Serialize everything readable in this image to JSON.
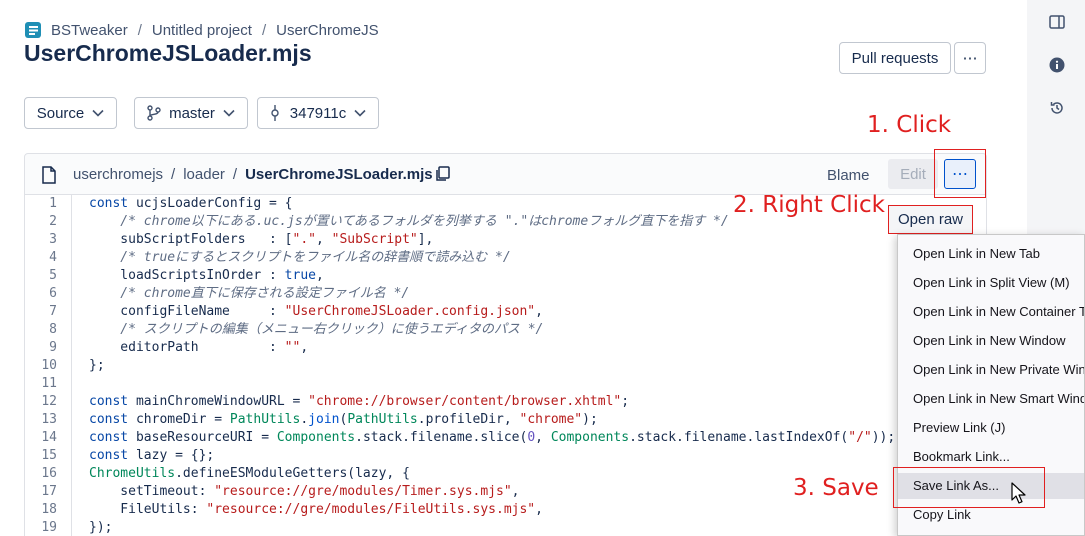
{
  "breadcrumb": {
    "workspace": "BSTweaker",
    "project": "Untitled project",
    "repo": "UserChromeJS"
  },
  "page_title": "UserChromeJSLoader.mjs",
  "header": {
    "pull_requests": "Pull requests",
    "more": "⋯"
  },
  "selectors": {
    "source": "Source",
    "branch": "master",
    "commit": "347911c"
  },
  "file_header": {
    "path": [
      "userchromejs",
      "loader"
    ],
    "current": "UserChromeJSLoader.mjs",
    "blame": "Blame",
    "edit": "Edit",
    "dots": "⋯",
    "open_raw": "Open raw"
  },
  "code_lines": [
    "1",
    "2",
    "3",
    "4",
    "5",
    "6",
    "7",
    "8",
    "9",
    "10",
    "11",
    "12",
    "13",
    "14",
    "15",
    "16",
    "17",
    "18",
    "19"
  ],
  "code": {
    "l1": [
      "const",
      " ucjsLoaderConfig = {"
    ],
    "l2": "    /* chrome以下にある.uc.jsが置いてあるフォルダを列挙する \".\"はchromeフォルグ直下を指す */",
    "l3": [
      "    subScriptFolders   : [",
      "\".\"",
      ", ",
      "\"SubScript\"",
      "],"
    ],
    "l4": "    /* trueにするとスクリプトをファイル名の辞書順で読み込む */",
    "l5": [
      "    loadScriptsInOrder : ",
      "true",
      ","
    ],
    "l6": "    /* chrome直下に保存される設定ファイル名 */",
    "l7": [
      "    configFileName     : ",
      "\"UserChromeJSLoader.config.json\"",
      ","
    ],
    "l8": "    /* スクリプトの編集（メニュー右クリック）に使うエディタのパス */",
    "l9": [
      "    editorPath         : ",
      "\"\"",
      ","
    ],
    "l10": "};",
    "l12": [
      "const",
      " mainChromeWindowURL = ",
      "\"chrome://browser/content/browser.xhtml\"",
      ";"
    ],
    "l13": [
      "const",
      " chromeDir = ",
      "PathUtils",
      ".",
      "join",
      "(",
      "PathUtils",
      ".profileDir, ",
      "\"chrome\"",
      ");"
    ],
    "l14": [
      "const",
      " baseResourceURI = ",
      "Components",
      ".stack.filename.slice(",
      "0",
      ", ",
      "Components",
      ".stack.filename.lastIndexOf(",
      "\"/\"",
      "));"
    ],
    "l15": [
      "const",
      " lazy = {};"
    ],
    "l16": [
      "ChromeUtils",
      ".defineESModuleGetters(lazy, {"
    ],
    "l17": [
      "    setTimeout: ",
      "\"resource://gre/modules/Timer.sys.mjs\"",
      ","
    ],
    "l18": [
      "    FileUtils: ",
      "\"resource://gre/modules/FileUtils.sys.mjs\"",
      ","
    ],
    "l19": "});"
  },
  "context_menu": [
    "Open Link in New Tab",
    "Open Link in Split View (M)",
    "Open Link in New Container Tab",
    "Open Link in New Window",
    "Open Link in New Private Window",
    "Open Link in New Smart Window",
    "Preview Link (J)",
    "Bookmark Link...",
    "Save Link As...",
    "Copy Link"
  ],
  "annotations": {
    "step1": "1. Click",
    "step2": "2. Right Click",
    "step3": "3. Save"
  },
  "icons": {
    "rail": [
      "sidebar-toggle-icon",
      "info-icon",
      "history-icon"
    ]
  },
  "colors": {
    "annotation": "#e02020",
    "accent": "#0052cc"
  }
}
